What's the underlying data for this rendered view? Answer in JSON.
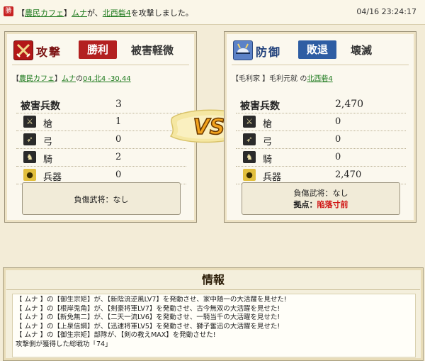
{
  "top": {
    "badge": "勝",
    "msg_prefix": "【",
    "msg_village": "農民カフェ",
    "msg_mid": "】",
    "msg_user": "ムナ",
    "msg_ga": "が、",
    "msg_target": "北西砦4",
    "msg_suffix": "を攻撃しました。",
    "time": "04/16 23:24:17"
  },
  "vs": {
    "text": "VS"
  },
  "attacker": {
    "title": "攻撃",
    "result": "勝利",
    "damage": "被害軽微",
    "who_pre": "【",
    "who_alliance": "農民カフェ",
    "who_mid": "】",
    "who_user": "ムナ",
    "who_no": "の",
    "who_coords": "04,北4 -30,44",
    "total_label": "被害兵数",
    "total_value": "3",
    "units": [
      {
        "label": "槍",
        "value": "1"
      },
      {
        "label": "弓",
        "value": "0"
      },
      {
        "label": "騎",
        "value": "2"
      },
      {
        "label": "兵器",
        "value": "0"
      }
    ],
    "casualty": "負傷武将：なし"
  },
  "defender": {
    "title": "防御",
    "result": "敗退",
    "damage": "壊滅",
    "who_pre": "【毛利家 】毛利元就 の",
    "who_target": "北西砦4",
    "total_label": "被害兵数",
    "total_value": "2,470",
    "units": [
      {
        "label": "槍",
        "value": "0"
      },
      {
        "label": "弓",
        "value": "0"
      },
      {
        "label": "騎",
        "value": "0"
      },
      {
        "label": "兵器",
        "value": "2,470"
      }
    ],
    "casualty": "負傷武将：なし",
    "capture_label": "拠点：",
    "capture_value": "陥落寸前"
  },
  "info": {
    "title": "情報",
    "lines": [
      "【 ムナ 】の【御生宗矩】が、【新陰流逆風LV7】を発動させ、家中随一の大活躍を見せた!",
      "【 ムナ 】の【根岸兎角】が、【剣豪将軍LV7】を発動させ、古今無双の大活躍を見せた!",
      "【 ムナ 】の【新免無二】が、【二天一流LV6】を発動させ、一騎当千の大活躍を見せた!",
      "【 ムナ 】の【上泉信綱】が、【迅速将軍LV5】を発動させ、獅子奮迅の大活躍を見せた!",
      "【 ムナ 】の【御生宗矩】部隊が、【剣の教えMAX】を発動させた!",
      "攻撃側が獲得した総戦功「74」"
    ]
  },
  "colors": {
    "win": "#b32020",
    "lose": "#2e5da3",
    "link": "#1e7a1e",
    "danger": "#d01515"
  },
  "icons": {
    "attack": "crossed-swords-icon",
    "defense": "helmet-icon",
    "spear": "spear-icon",
    "bow": "bow-icon",
    "cavalry": "horse-icon",
    "siege": "cannon-icon"
  }
}
